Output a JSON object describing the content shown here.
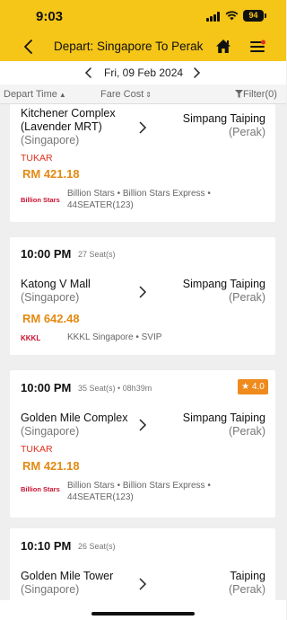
{
  "status": {
    "time": "9:03",
    "battery": "94"
  },
  "header": {
    "title": "Depart: Singapore To Perak"
  },
  "date": {
    "label": "Fri, 09 Feb 2024"
  },
  "sort": {
    "depart": "Depart Time",
    "fare": "Fare Cost",
    "filter": "Filter(0)"
  },
  "trips": [
    {
      "from": "Kitchener Complex",
      "from2": "(Lavender MRT)",
      "from_state": "(Singapore)",
      "to": "Simpang Taiping",
      "to_state": "(Perak)",
      "tag": "TUKAR",
      "price": "RM 421.18",
      "logo_text": "Billion Stars",
      "operator": "Billion Stars • Billion Stars Express • 44SEATER(123)"
    },
    {
      "time": "10:00 PM",
      "seats": "27 Seat(s)",
      "from": "Katong V Mall",
      "from_state": "(Singapore)",
      "to": "Simpang Taiping",
      "to_state": "(Perak)",
      "price": "RM 642.48",
      "logo_text": "KKKL",
      "operator": "KKKL Singapore • SVIP"
    },
    {
      "time": "10:00 PM",
      "seats": "35 Seat(s) • 08h39m",
      "rating": "★ 4.0",
      "from": "Golden Mile Complex",
      "from_state": "(Singapore)",
      "to": "Simpang Taiping",
      "to_state": "(Perak)",
      "tag": "TUKAR",
      "price": "RM 421.18",
      "logo_text": "Billion Stars",
      "operator": "Billion Stars • Billion Stars Express • 44SEATER(123)"
    },
    {
      "time": "10:10 PM",
      "seats": "26 Seat(s)",
      "from": "Golden Mile Tower",
      "from_state": "(Singapore)",
      "to": "Taiping",
      "to_state": "(Perak)"
    }
  ],
  "colors": {
    "brand": "#f5c518",
    "price": "#e38a11",
    "tag": "#e0301e",
    "rating": "#ef8a1c"
  },
  "icons": [
    "back-chevron-icon",
    "home-icon",
    "menu-icon",
    "chevron-left-icon",
    "chevron-right-icon",
    "filter-icon",
    "arrow-right-icon"
  ]
}
